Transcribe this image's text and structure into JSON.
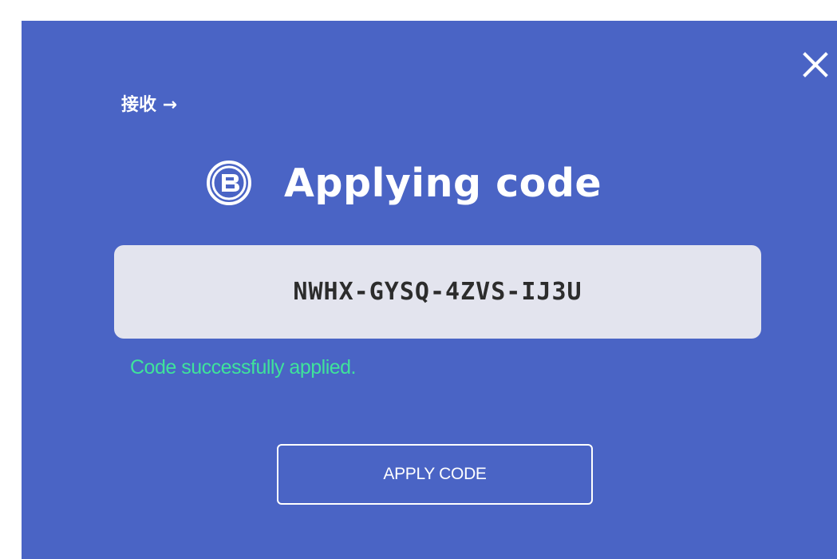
{
  "dialog": {
    "receive_link": "接收 →",
    "title": "Applying code",
    "code_value": "NWHX-GYSQ-4ZVS-IJ3U",
    "status_message": "Code successfully applied.",
    "apply_button_label": "APPLY CODE",
    "close_icon": "close-icon",
    "title_icon": "brand-logo-icon"
  },
  "colors": {
    "background": "#4a64c5",
    "code_box": "#e3e4ee",
    "success": "#3fe39b",
    "text": "#ffffff"
  }
}
